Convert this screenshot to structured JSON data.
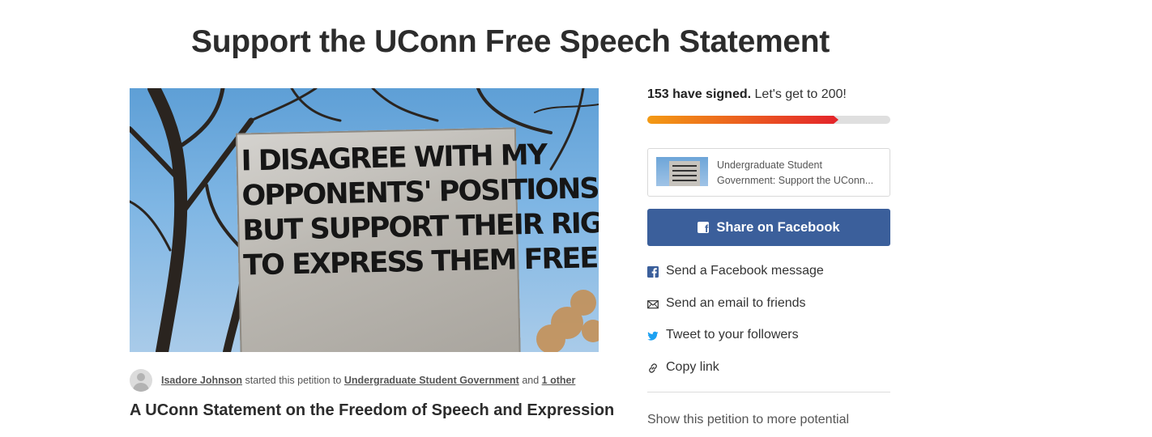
{
  "page": {
    "title": "Support the UConn Free Speech Statement"
  },
  "hero": {
    "sign_lines": [
      "I DISAGREE WITH MY",
      "OPPONENTS' POSITIONS",
      "BUT SUPPORT THEIR RIGHT",
      "TO EXPRESS THEM FREELY !"
    ]
  },
  "byline": {
    "author": "Isadore Johnson",
    "middle": "started this petition to",
    "target": "Undergraduate Student Government",
    "and": "and",
    "others": "1 other"
  },
  "petition": {
    "heading": "A UConn Statement on the Freedom of Speech and Expression"
  },
  "progress": {
    "signed_bold": "153 have signed.",
    "goal_text": "Let's get to 200!",
    "signed": 153,
    "goal": 200,
    "fill_color_start": "#f39a14",
    "fill_color_end": "#e4262a"
  },
  "preview": {
    "line1": "Undergraduate Student",
    "line2": "Government: Support the UConn..."
  },
  "share": {
    "facebook_button": "Share on Facebook",
    "facebook_button_color": "#3b5f9b",
    "items": [
      {
        "label": "Send a Facebook message",
        "icon": "facebook-icon"
      },
      {
        "label": "Send an email to friends",
        "icon": "email-icon"
      },
      {
        "label": "Tweet to your followers",
        "icon": "twitter-icon"
      },
      {
        "label": "Copy link",
        "icon": "link-icon"
      }
    ],
    "more_text": "Show this petition to more potential"
  }
}
